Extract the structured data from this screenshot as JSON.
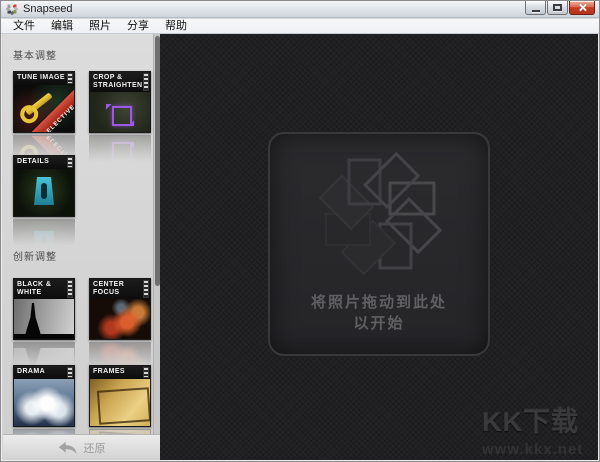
{
  "window": {
    "title": "Snapseed"
  },
  "menu": {
    "items": [
      "文件",
      "编辑",
      "照片",
      "分享",
      "帮助"
    ]
  },
  "sidebar": {
    "section1_label": "基本调整",
    "section2_label": "创新调整",
    "tiles": {
      "tune_image": {
        "label": "TUNE IMAGE",
        "ribbon": "SELECTIVE"
      },
      "crop": {
        "label": "CROP & STRAIGHTEN"
      },
      "details": {
        "label": "DETAILS"
      },
      "black_white": {
        "label": "BLACK & WHITE"
      },
      "center_focus": {
        "label": "CENTER FOCUS"
      },
      "drama": {
        "label": "DRAMA"
      },
      "frames": {
        "label": "FRAMES"
      }
    },
    "revert_label": "还原"
  },
  "canvas": {
    "drop_line1": "将照片拖动到此处",
    "drop_line2": "以开始"
  },
  "watermark": {
    "title": "KK下载",
    "url": "www.kkx.net"
  },
  "colors": {
    "close_button": "#c83c22",
    "ribbon_red": "#b5271a",
    "wrench_yellow": "#e7c537",
    "crop_purple": "#9b59e8",
    "details_cyan": "#39b7c9",
    "canvas_bg": "#232326",
    "sidebar_bg": "#d5d5d5"
  }
}
